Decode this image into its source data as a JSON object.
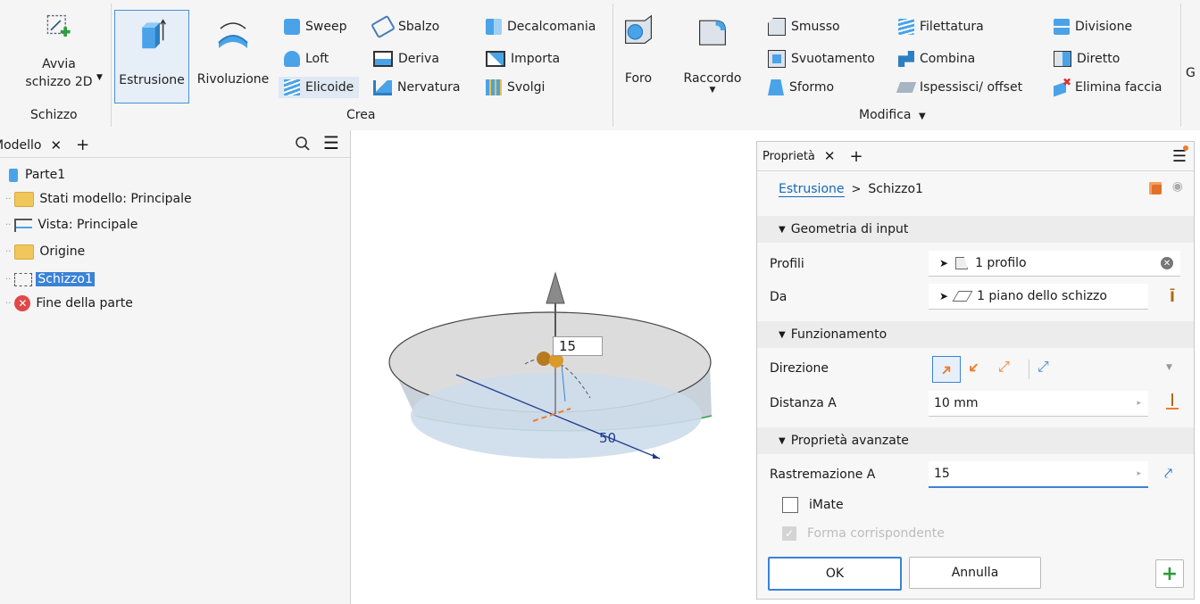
{
  "ribbon": {
    "schizzo": {
      "start_sketch": "Avvia\nschizzo 2D",
      "panel": "Schizzo"
    },
    "crea": {
      "panel": "Crea",
      "estrusione": "Estrusione",
      "rivoluzione": "Rivoluzione",
      "sweep": "Sweep",
      "loft": "Loft",
      "elicoide": "Elicoide",
      "sbalzo": "Sbalzo",
      "deriva": "Deriva",
      "nervatura": "Nervatura",
      "decalcomania": "Decalcomania",
      "importa": "Importa",
      "svolgi": "Svolgi"
    },
    "modifica": {
      "panel": "Modifica",
      "foro": "Foro",
      "raccordo": "Raccordo",
      "smusso": "Smusso",
      "svuotamento": "Svuotamento",
      "sformo": "Sformo",
      "filettatura": "Filettatura",
      "combina": "Combina",
      "ispessisci": "Ispessisci/ offset",
      "divisione": "Divisione",
      "diretto": "Diretto",
      "elimina_faccia": "Elimina faccia"
    },
    "overflow_label": "G"
  },
  "tree": {
    "tab": "Modello",
    "items": [
      {
        "label": "Parte1",
        "icon": "part-icon"
      },
      {
        "label": "Stati modello: Principale",
        "icon": "folder-icon"
      },
      {
        "label": "Vista: Principale",
        "icon": "view-icon"
      },
      {
        "label": "Origine",
        "icon": "folder-icon"
      },
      {
        "label": "Schizzo1",
        "icon": "sketch-icon"
      },
      {
        "label": "Fine della parte",
        "icon": "end-of-part-icon"
      }
    ]
  },
  "viewport": {
    "dim_label": "15",
    "dim_diameter": "50"
  },
  "props": {
    "tab": "Proprietà",
    "breadcrumb_link": "Estrusione",
    "breadcrumb_sep": ">",
    "breadcrumb_current": "Schizzo1",
    "section_input": "Geometria di input",
    "profili_label": "Profili",
    "profili_value": "1 profilo",
    "da_label": "Da",
    "da_value": "1 piano dello schizzo",
    "section_behavior": "Funzionamento",
    "direzione_label": "Direzione",
    "distanza_label": "Distanza A",
    "distanza_value": "10 mm",
    "section_advanced": "Proprietà avanzate",
    "rastremazione_label": "Rastremazione A",
    "rastremazione_value": "15",
    "imate_label": "iMate",
    "forma_label": "Forma corrispondente",
    "ok": "OK",
    "cancel": "Annulla"
  },
  "colors": {
    "accent": "#1668b8",
    "selection": "#3b82d6",
    "orange": "#f07c2a",
    "green": "#2a9d3b"
  }
}
